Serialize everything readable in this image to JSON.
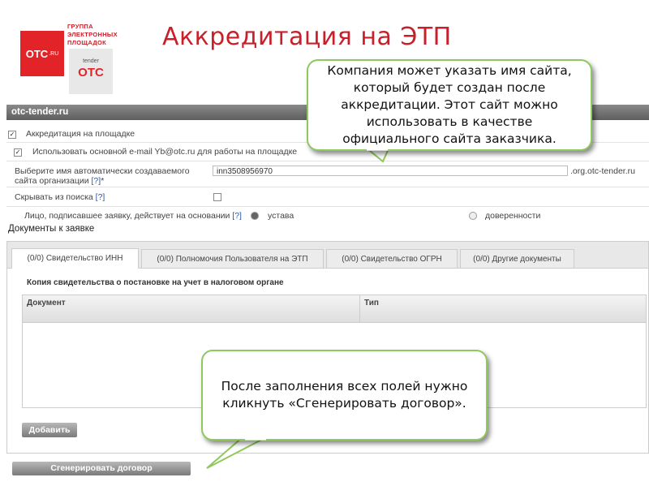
{
  "slide_title": "Аккредитация на ЭТП",
  "logo": {
    "brand": "OTC",
    "domain": ".RU",
    "group_text": "ГРУППА ЭЛЕКТРОННЫХ ПЛОЩАДОК",
    "tender_small": "tender",
    "tender_big": "OTC"
  },
  "site_bar": "otc-tender.ru",
  "form": {
    "accreditation_label": "Аккредитация на площадке",
    "email_label": "Использовать основной e-mail Yb@otc.ru для работы на площадке",
    "org_name_label": "Выберите имя автоматически создаваемого сайта организации",
    "help_link": "[?]",
    "required_mark": "*",
    "org_input_value": "inn3508956970",
    "org_suffix": ".org.otc-tender.ru",
    "hide_search_label": "Скрывать из поиска",
    "signer_label": "Лицо, подписавшее заявку, действует на основании",
    "radio_charter": "устава",
    "radio_proxy": "доверенности"
  },
  "documents": {
    "title": "Документы к заявке",
    "tabs": [
      "(0/0) Свидетельство ИНН",
      "(0/0) Полномочия Пользователя на ЭТП",
      "(0/0) Свидетельство ОГРН",
      "(0/0) Другие документы"
    ],
    "section_heading": "Копия свидетельства о постановке на учет в налоговом органе",
    "columns": [
      "Документ",
      "Тип"
    ],
    "add_button": "Добавить",
    "generate_button": "Сгенерировать договор"
  },
  "callouts": {
    "top": "Компания может указать имя сайта, который будет создан после аккредитации. Этот сайт можно использовать в качестве официального сайта заказчика.",
    "bottom": "После заполнения всех полей нужно кликнуть «Сгенерировать договор»."
  },
  "colors": {
    "brand_red": "#e22428",
    "title_red": "#c8202a",
    "callout_border": "#8fc85c",
    "link_blue": "#2a5aa8"
  }
}
